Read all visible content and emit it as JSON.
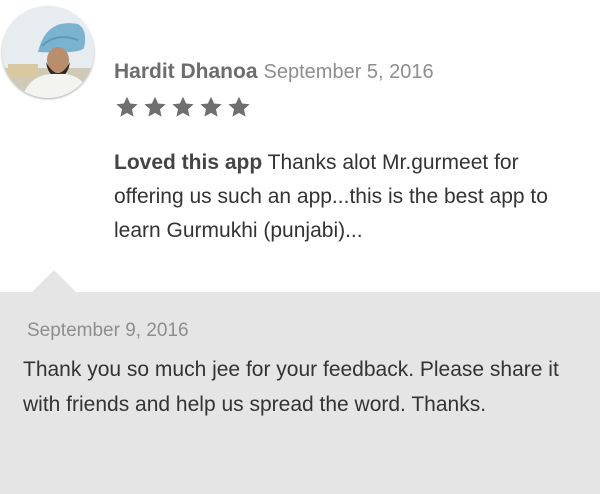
{
  "review": {
    "author": "Hardit Dhanoa",
    "date": "September 5, 2016",
    "rating": 5,
    "rating_max": 5,
    "title": "Loved this app",
    "text": " Thanks alot Mr.gurmeet for offering us such an app...this is the best app to learn Gurmukhi (punjabi)...",
    "star_color": "#6f6f6f"
  },
  "reply": {
    "date": "September 9, 2016",
    "text": "Thank you so much jee for your feedback. Please share it with friends and help us spread the word. Thanks.",
    "background_color": "#e5e5e5"
  }
}
